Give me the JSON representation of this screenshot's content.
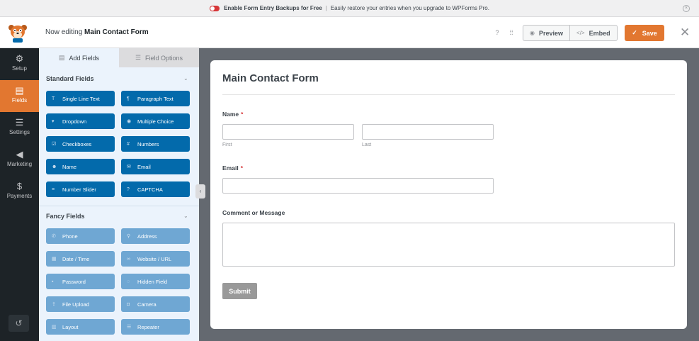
{
  "notice": {
    "bold_text": "Enable Form Entry Backups for Free",
    "separator": "|",
    "text": "Easily restore your entries when you upgrade to WPForms Pro."
  },
  "header": {
    "editing_prefix": "Now editing",
    "form_name": "Main Contact Form",
    "preview_label": "Preview",
    "embed_label": "Embed",
    "save_label": "Save"
  },
  "nav": {
    "items": [
      {
        "label": "Setup",
        "icon": "gear-icon"
      },
      {
        "label": "Fields",
        "icon": "fields-icon"
      },
      {
        "label": "Settings",
        "icon": "sliders-icon"
      },
      {
        "label": "Marketing",
        "icon": "megaphone-icon"
      },
      {
        "label": "Payments",
        "icon": "dollar-icon"
      }
    ]
  },
  "panel": {
    "tab_add_fields": "Add Fields",
    "tab_field_options": "Field Options",
    "standard_title": "Standard Fields",
    "fancy_title": "Fancy Fields",
    "standard_fields": [
      {
        "label": "Single Line Text",
        "icon": "T"
      },
      {
        "label": "Paragraph Text",
        "icon": "¶"
      },
      {
        "label": "Dropdown",
        "icon": "▾"
      },
      {
        "label": "Multiple Choice",
        "icon": "◉"
      },
      {
        "label": "Checkboxes",
        "icon": "☑"
      },
      {
        "label": "Numbers",
        "icon": "#"
      },
      {
        "label": "Name",
        "icon": "☻"
      },
      {
        "label": "Email",
        "icon": "✉"
      },
      {
        "label": "Number Slider",
        "icon": "≡"
      },
      {
        "label": "CAPTCHA",
        "icon": "?"
      }
    ],
    "fancy_fields": [
      {
        "label": "Phone",
        "icon": "✆"
      },
      {
        "label": "Address",
        "icon": "⚲"
      },
      {
        "label": "Date / Time",
        "icon": "▦"
      },
      {
        "label": "Website / URL",
        "icon": "∞"
      },
      {
        "label": "Password",
        "icon": "▪"
      },
      {
        "label": "Hidden Field",
        "icon": "◌"
      },
      {
        "label": "File Upload",
        "icon": "⇪"
      },
      {
        "label": "Camera",
        "icon": "◘"
      },
      {
        "label": "Layout",
        "icon": "▥"
      },
      {
        "label": "Repeater",
        "icon": "☰"
      }
    ]
  },
  "form": {
    "title": "Main Contact Form",
    "name_label": "Name",
    "required_mark": "*",
    "first_sublabel": "First",
    "last_sublabel": "Last",
    "email_label": "Email",
    "comment_label": "Comment or Message",
    "submit_label": "Submit"
  },
  "colors": {
    "accent": "#e27730",
    "field_button": "#036aab",
    "fancy_field_button": "#6fa7d3",
    "nav_bg": "#1d2327"
  }
}
